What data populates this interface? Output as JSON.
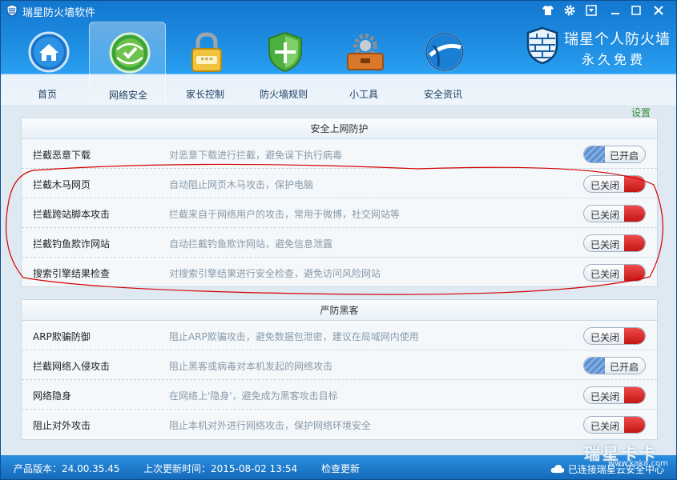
{
  "app": {
    "title": "瑞星防火墙软件"
  },
  "brand": {
    "line1": "瑞星个人防火墙",
    "line2": "永久免费"
  },
  "nav": [
    {
      "label": "首页",
      "icon": "home-icon"
    },
    {
      "label": "网络安全",
      "icon": "network-security-icon",
      "active": true
    },
    {
      "label": "家长控制",
      "icon": "padlock-icon"
    },
    {
      "label": "防火墙规则",
      "icon": "shield-icon"
    },
    {
      "label": "小工具",
      "icon": "toolbox-icon"
    },
    {
      "label": "安全资讯",
      "icon": "globe-icon"
    }
  ],
  "settings_label": "设置",
  "panels": [
    {
      "title": "安全上网防护",
      "rows": [
        {
          "name": "拦截恶意下载",
          "desc": "对恶意下载进行拦截，避免误下执行病毒",
          "state": "已开启",
          "on": true
        },
        {
          "name": "拦截木马网页",
          "desc": "自动阻止网页木马攻击，保护电脑",
          "state": "已关闭",
          "on": false
        },
        {
          "name": "拦截跨站脚本攻击",
          "desc": "拦截来自于网络用户的攻击，常用于微博，社交网站等",
          "state": "已关闭",
          "on": false
        },
        {
          "name": "拦截钓鱼欺诈网站",
          "desc": "自动拦截钓鱼欺诈网站，避免信息泄露",
          "state": "已关闭",
          "on": false
        },
        {
          "name": "搜索引擎结果检查",
          "desc": "对搜索引擎结果进行安全检查，避免访问风险网站",
          "state": "已关闭",
          "on": false
        }
      ]
    },
    {
      "title": "严防黑客",
      "rows": [
        {
          "name": "ARP欺骗防御",
          "desc": "阻止ARP欺骗攻击，避免数据包泄密，建议在局域网内使用",
          "state": "已关闭",
          "on": false
        },
        {
          "name": "拦截网络入侵攻击",
          "desc": "阻止黑客或病毒对本机发起的网络攻击",
          "state": "已开启",
          "on": true
        },
        {
          "name": "网络隐身",
          "desc": "在网络上'隐身'，避免成为黑客攻击目标",
          "state": "已关闭",
          "on": false
        },
        {
          "name": "阻止对外攻击",
          "desc": "阻止本机对外进行网络攻击，保护网络环境安全",
          "state": "已关闭",
          "on": false
        }
      ]
    }
  ],
  "status": {
    "version": "产品版本：24.00.35.45",
    "updated": "上次更新时间：2015-08-02 13:54",
    "check_update": "检查更新",
    "cloud": "已连接瑞星云安全中心"
  },
  "watermark": {
    "text": "瑞星卡卡",
    "url": "www.kaka.com"
  },
  "colors": {
    "header_blue": "#1f8fe3",
    "toggle_off_red": "#c41616",
    "toggle_on_blue": "#5a8fd1",
    "annotation_red": "#d40000",
    "settings_green": "#3a8a3a"
  }
}
